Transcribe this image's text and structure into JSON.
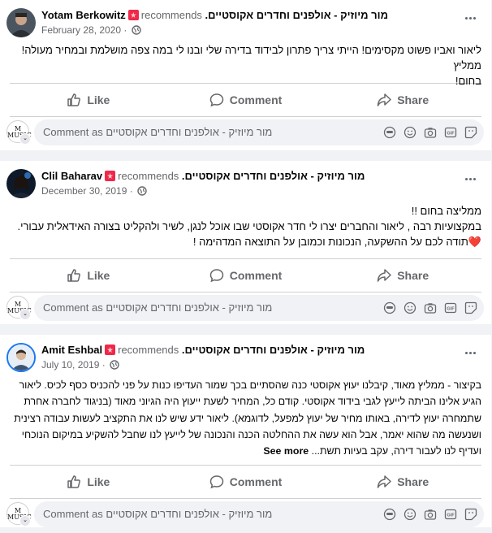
{
  "labels": {
    "recommends": "recommends",
    "like": "Like",
    "comment": "Comment",
    "share": "Share",
    "comment_placeholder": "Comment as מור מיוזיק - אולפנים וחדרים אקוסטיים",
    "see_more": "See more"
  },
  "page_name": "מור מיוזיק - אולפנים וחדרים אקוסטיים.",
  "posts": [
    {
      "author": "Yotam Berkowitz",
      "date": "February 28, 2020",
      "lines": [
        "ליאור ואביו פשוט מקסימים! הייתי צריך פתרון לבידוד בדירה שלי ובנו לי במה צפה מושלמת ובמחיר מעולה! ממליץ",
        "בחום!"
      ]
    },
    {
      "author": "Clil Baharav",
      "date": "December 30, 2019",
      "lines": [
        "ממליצה בחום !!",
        "במקצועיות רבה , ליאור והחברים יצרו לי חדר אקוסטי שבו אוכל לנגן, לשיר ולהקליט בצורה האידאלית עבורי.",
        "תודה לכם על ההשקעה, הנכונות וכמובן על התוצאה המדהימה !"
      ]
    },
    {
      "author": "Amit Eshbal",
      "date": "July 10, 2019",
      "lines": [
        "בקיצור - ממליץ מאוד, קיבלנו יעוץ אקוסטי כנה שהסתיים בכך שמור העדיפו כנות על פני להכניס כסף לכיס. ליאור",
        "הגיע אלינו הביתה לייעץ לגבי בידוד אקוסטי. קודם כל, המחיר לשעת ייעוץ היה הגיוני מאוד (בניגוד לחברה אחרת",
        "שתמחרה יעוץ לדירה, באותו מחיר של יעוץ למפעל, לדוגמא). ליאור ידע שיש לנו את התקציב לעשות עבודה רצינית",
        "ושנעשה מה שהוא יאמר, אבל הוא עשה את ההחלטה הכנה והנכונה של לייעץ לנו שחבל להשקיע במיקום הנוכחי",
        "ועדיף לנו לעבור דירה, עקב בעיות תשת..."
      ]
    }
  ]
}
